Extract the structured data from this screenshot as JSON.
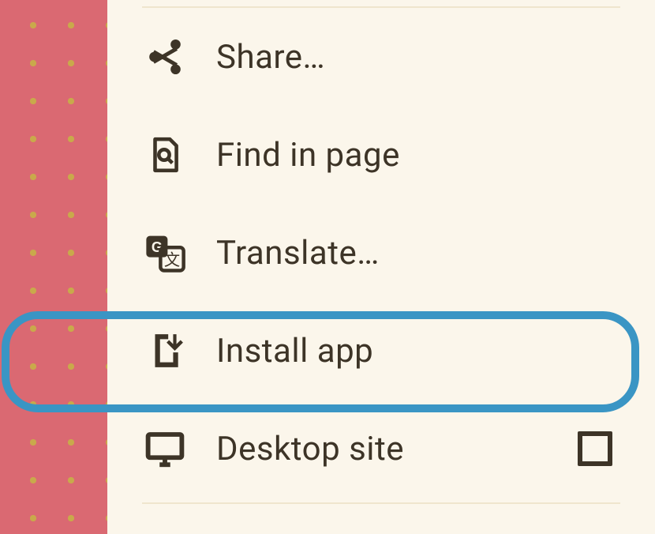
{
  "menu": {
    "share": {
      "label": "Share…"
    },
    "find": {
      "label": "Find in page"
    },
    "translate": {
      "label": "Translate…"
    },
    "install": {
      "label": "Install app"
    },
    "desktop": {
      "label": "Desktop site",
      "checked": false
    }
  },
  "highlighted": "install"
}
